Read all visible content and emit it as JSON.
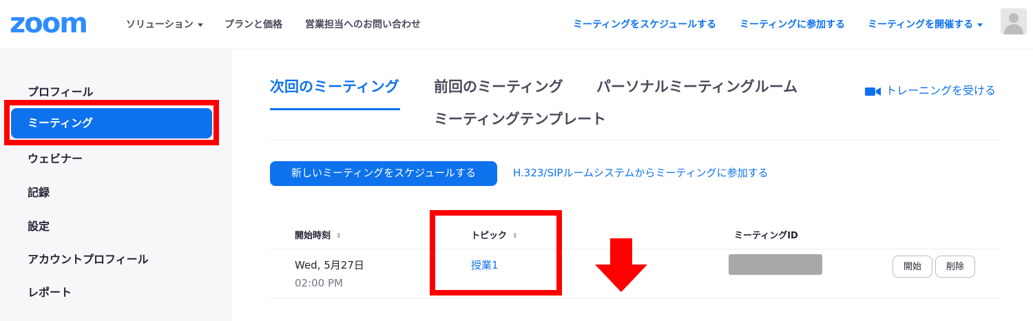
{
  "header": {
    "logo": "zoom",
    "nav_left": [
      {
        "label": "ソリューション",
        "dropdown": true
      },
      {
        "label": "プランと価格",
        "dropdown": false
      },
      {
        "label": "営業担当へのお問い合わせ",
        "dropdown": false
      }
    ],
    "nav_right": [
      {
        "label": "ミーティングをスケジュールする",
        "dropdown": false
      },
      {
        "label": "ミーティングに参加する",
        "dropdown": false
      },
      {
        "label": "ミーティングを開催する",
        "dropdown": true
      }
    ],
    "avatar_icon": "user-avatar-icon"
  },
  "sidebar": {
    "items": [
      {
        "label": "プロフィール"
      },
      {
        "label": "ミーティング",
        "active": true
      },
      {
        "label": "ウェビナー"
      },
      {
        "label": "記録"
      },
      {
        "label": "設定"
      },
      {
        "label": "アカウントプロフィール"
      },
      {
        "label": "レポート"
      }
    ]
  },
  "tabs": [
    {
      "label": "次回のミーティング",
      "active": true
    },
    {
      "label": "前回のミーティング"
    },
    {
      "label": "パーソナルミーティングルーム"
    },
    {
      "label": "ミーティングテンプレート"
    }
  ],
  "training_link": {
    "label": "トレーニングを受ける",
    "icon": "video-camera-icon"
  },
  "actions": {
    "schedule_button": "新しいミーティングをスケジュールする",
    "h323_link": "H.323/SIPルームシステムからミーティングに参加する"
  },
  "table": {
    "headers": [
      "開始時刻",
      "トピック",
      "ミーティングID"
    ],
    "sort_icon": "⇕",
    "rows": [
      {
        "date": "Wed, 5月27日",
        "time": "02:00 PM",
        "topic": "授業1",
        "meeting_id": "",
        "meeting_id_masked": true,
        "actions": [
          "開始",
          "削除"
        ]
      }
    ]
  },
  "annotations": {
    "highlight_color": "#ff0000",
    "arrow_direction": "down"
  },
  "colors": {
    "brand": "#2d8cff",
    "accent": "#0e72ed",
    "sidebar_bg": "#f7f7fa",
    "text": "#232333"
  }
}
